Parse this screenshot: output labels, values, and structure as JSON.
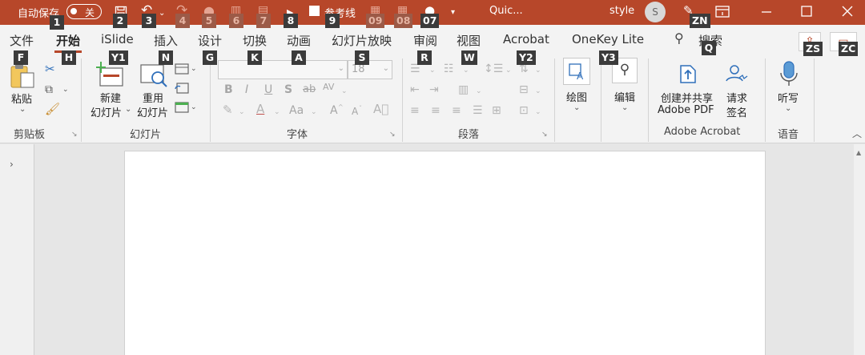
{
  "titlebar": {
    "autosave_label": "自动保存",
    "autosave_state": "关",
    "gridlines_label": "参考线",
    "doc_title": "Quic...",
    "style_label": "style",
    "avatar_initial": "S",
    "bg_color": "#b7472a"
  },
  "keytips": {
    "k1": "1",
    "k2": "2",
    "k3": "3",
    "k4": "4",
    "k5": "5",
    "k6": "6",
    "k7": "7",
    "k8": "8",
    "k9": "9",
    "k09": "09",
    "k08": "08",
    "k07": "07",
    "kZN": "ZN",
    "kF": "F",
    "kH": "H",
    "kY1": "Y1",
    "kN": "N",
    "kG": "G",
    "kK": "K",
    "kA": "A",
    "kS": "S",
    "kR": "R",
    "kW": "W",
    "kY2": "Y2",
    "kY3": "Y3",
    "kQ": "Q",
    "kZS": "ZS",
    "kZC": "ZC"
  },
  "tabs": {
    "file": "文件",
    "home": "开始",
    "islide": "iSlide",
    "insert": "插入",
    "design": "设计",
    "transitions": "切换",
    "animations": "动画",
    "slideshow": "幻灯片放映",
    "review": "审阅",
    "view": "视图",
    "acrobat": "Acrobat",
    "onekey": "OneKey Lite",
    "search": "搜索"
  },
  "ribbon": {
    "paste": "粘贴",
    "clipboard_group": "剪贴板",
    "new_slide_1": "新建",
    "new_slide_2": "幻灯片",
    "reuse_slide_1": "重用",
    "reuse_slide_2": "幻灯片",
    "slides_group": "幻灯片",
    "font_size": "18",
    "font_group": "字体",
    "paragraph_group": "段落",
    "draw": "绘图",
    "edit": "编辑",
    "create_share_1": "创建并共享",
    "create_share_2": "Adobe PDF",
    "request_sign_1": "请求",
    "request_sign_2": "签名",
    "acrobat_group": "Adobe Acrobat",
    "dictate": "听写",
    "voice_group": "语音",
    "bold": "B",
    "italic": "I",
    "underline": "U",
    "shadow": "S",
    "strike": "ab",
    "spacing": "AV",
    "case": "Aa",
    "grow": "A",
    "shrink": "A"
  },
  "colors": {
    "accent": "#b7472a",
    "ribbon_bg": "#f3f3f3",
    "workspace_bg": "#e6e6e6"
  }
}
